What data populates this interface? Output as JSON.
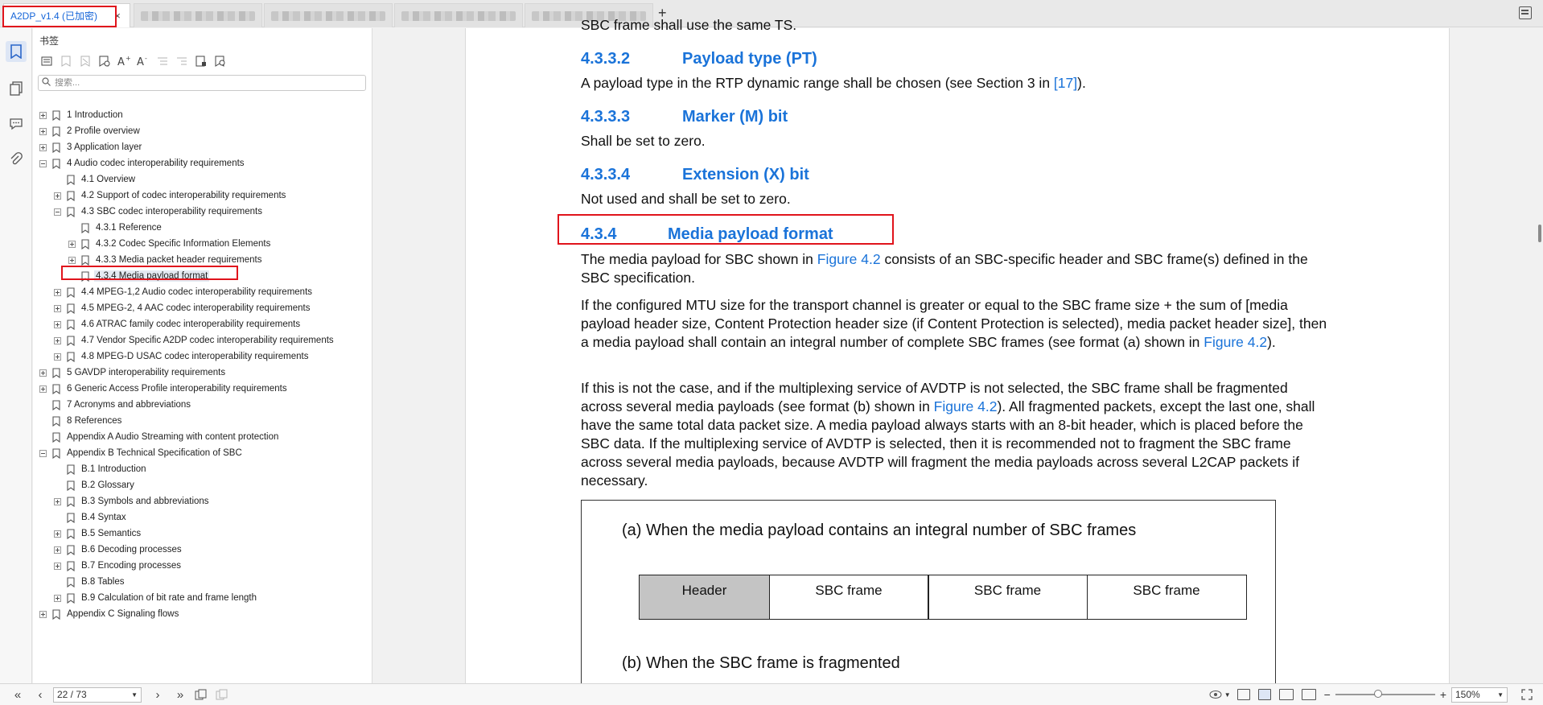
{
  "tabs": {
    "active_title": "A2DP_v1.4 (已加密)",
    "close_glyph": "×",
    "add_glyph": "+"
  },
  "sidebar": {
    "title": "书签",
    "search_placeholder": "搜索...",
    "bookmarks": [
      {
        "label": "1 Introduction",
        "level": 0,
        "toggle": "plus"
      },
      {
        "label": "2 Profile overview",
        "level": 0,
        "toggle": "plus"
      },
      {
        "label": "3 Application layer",
        "level": 0,
        "toggle": "plus"
      },
      {
        "label": "4 Audio codec interoperability requirements",
        "level": 0,
        "toggle": "minus"
      },
      {
        "label": "4.1 Overview",
        "level": 1,
        "toggle": "none"
      },
      {
        "label": "4.2 Support of codec interoperability requirements",
        "level": 1,
        "toggle": "plus"
      },
      {
        "label": "4.3 SBC codec interoperability requirements",
        "level": 1,
        "toggle": "minus"
      },
      {
        "label": "4.3.1 Reference",
        "level": 2,
        "toggle": "none"
      },
      {
        "label": "4.3.2 Codec Specific Information Elements",
        "level": 2,
        "toggle": "plus"
      },
      {
        "label": "4.3.3 Media packet header requirements",
        "level": 2,
        "toggle": "plus"
      },
      {
        "label": "4.3.4 Media payload format",
        "level": 2,
        "toggle": "none",
        "selected": true
      },
      {
        "label": "4.4 MPEG-1,2 Audio codec interoperability requirements",
        "level": 1,
        "toggle": "plus"
      },
      {
        "label": "4.5 MPEG-2, 4 AAC codec interoperability requirements",
        "level": 1,
        "toggle": "plus"
      },
      {
        "label": "4.6 ATRAC family codec interoperability requirements",
        "level": 1,
        "toggle": "plus"
      },
      {
        "label": "4.7 Vendor Specific A2DP codec interoperability requirements",
        "level": 1,
        "toggle": "plus"
      },
      {
        "label": "4.8 MPEG-D USAC codec interoperability requirements",
        "level": 1,
        "toggle": "plus"
      },
      {
        "label": "5 GAVDP interoperability requirements",
        "level": 0,
        "toggle": "plus"
      },
      {
        "label": "6 Generic Access Profile interoperability requirements",
        "level": 0,
        "toggle": "plus"
      },
      {
        "label": "7 Acronyms and abbreviations",
        "level": 0,
        "toggle": "none"
      },
      {
        "label": "8 References",
        "level": 0,
        "toggle": "none"
      },
      {
        "label": "Appendix A Audio Streaming with content protection",
        "level": 0,
        "toggle": "none"
      },
      {
        "label": "Appendix B Technical Specification of SBC",
        "level": 0,
        "toggle": "minus"
      },
      {
        "label": "B.1 Introduction",
        "level": 1,
        "toggle": "none"
      },
      {
        "label": "B.2 Glossary",
        "level": 1,
        "toggle": "none"
      },
      {
        "label": "B.3 Symbols and abbreviations",
        "level": 1,
        "toggle": "plus"
      },
      {
        "label": "B.4  Syntax",
        "level": 1,
        "toggle": "none"
      },
      {
        "label": "B.5 Semantics",
        "level": 1,
        "toggle": "plus"
      },
      {
        "label": "B.6 Decoding processes",
        "level": 1,
        "toggle": "plus"
      },
      {
        "label": "B.7 Encoding processes",
        "level": 1,
        "toggle": "plus"
      },
      {
        "label": "B.8 Tables",
        "level": 1,
        "toggle": "none"
      },
      {
        "label": "B.9 Calculation of bit rate and frame length",
        "level": 1,
        "toggle": "plus"
      },
      {
        "label": "Appendix C Signaling flows",
        "level": 0,
        "toggle": "plus"
      }
    ]
  },
  "document": {
    "prev_line": "SBC frame shall use the same TS.",
    "s4332": {
      "num": "4.3.3.2",
      "title": "Payload type (PT)"
    },
    "s4332_text_a": "A payload type in the RTP dynamic range shall be chosen (see Section 3 in ",
    "s4332_ref": "[17]",
    "s4332_text_b": ").",
    "s4333": {
      "num": "4.3.3.3",
      "title": "Marker (M) bit"
    },
    "s4333_text": "Shall be set to zero.",
    "s4334": {
      "num": "4.3.3.4",
      "title": "Extension (X) bit"
    },
    "s4334_text": "Not used and shall be set to zero.",
    "s434": {
      "num": "4.3.4",
      "title": "Media payload format"
    },
    "p1_a": "The media payload for SBC shown in ",
    "p1_link": "Figure 4.2",
    "p1_b": " consists of an SBC-specific header and SBC frame(s) defined in the SBC specification.",
    "p2_a": "If the configured MTU size for the transport channel is greater or equal to the SBC frame size + the sum of [media payload header size, Content Protection header size (if Content Protection is selected), media packet header size], then a media payload shall contain an integral number of complete SBC frames (see format (a) shown in ",
    "p2_link": "Figure 4.2",
    "p2_b": ").",
    "p3_a": "If this is not the case, and if the multiplexing service of AVDTP is not selected, the SBC frame shall be fragmented across several media payloads (see format (b) shown in ",
    "p3_link": "Figure 4.2",
    "p3_b": "). All fragmented packets, except the last one, shall have the same total data packet size. A media payload always starts with an 8-bit header, which is placed before the SBC data. If the multiplexing service of AVDTP is selected, then it is recommended not to fragment the SBC frame across several media payloads, because AVDTP will fragment the media payloads across several L2CAP packets if necessary.",
    "figure": {
      "caption_a": "(a) When the media payload contains an integral number of SBC frames",
      "header_cell": "Header",
      "frame_cell": "SBC frame",
      "caption_b": "(b) When the SBC frame is fragmented"
    }
  },
  "status": {
    "page_indicator": "22 / 73",
    "zoom": "150%",
    "zoom_fraction": 0.43
  },
  "colors": {
    "accent": "#1a73d9",
    "highlight": "#e0141c"
  }
}
